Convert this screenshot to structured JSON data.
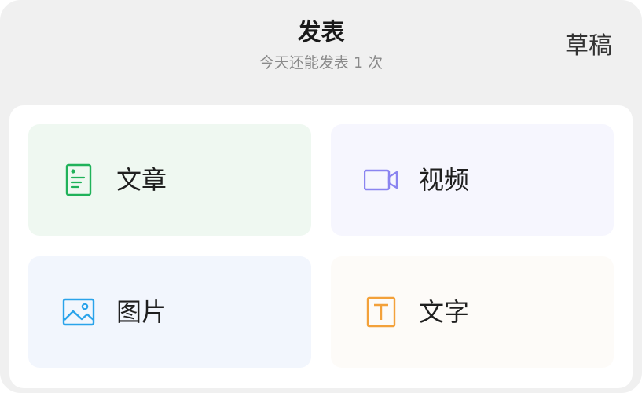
{
  "header": {
    "title": "发表",
    "subtitle": "今天还能发表 1 次",
    "draft_label": "草稿"
  },
  "options": [
    {
      "label": "文章",
      "icon": "document-icon",
      "icon_color": "#20b25a",
      "tile_color": "#eff8f1"
    },
    {
      "label": "视频",
      "icon": "video-camera-icon",
      "icon_color": "#8a84f0",
      "tile_color": "#f6f6fe"
    },
    {
      "label": "图片",
      "icon": "image-icon",
      "icon_color": "#2aa3ea",
      "tile_color": "#f2f6fd"
    },
    {
      "label": "文字",
      "icon": "text-icon",
      "icon_color": "#f3a13a",
      "tile_color": "#fdfbf8"
    }
  ],
  "colors": {
    "sheet_background": "#f0f0f0",
    "panel_background": "#ffffff",
    "title_text": "#1a1a1a",
    "subtitle_text": "#8a8a8a"
  }
}
